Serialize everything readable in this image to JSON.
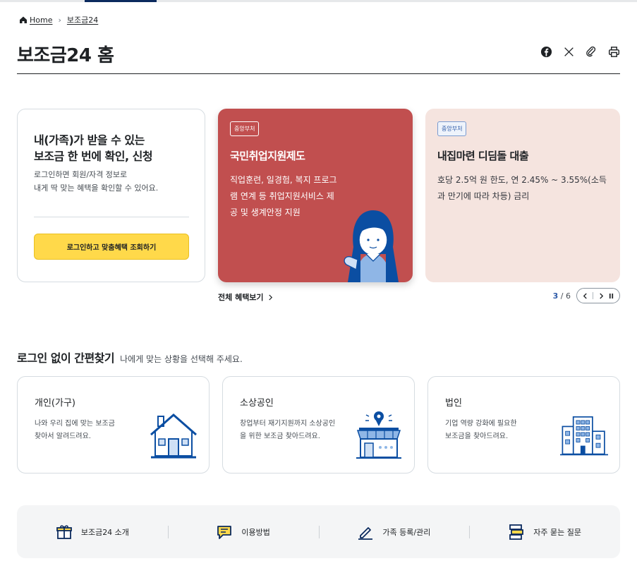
{
  "breadcrumb": {
    "home": "Home",
    "current": "보조금24"
  },
  "page": {
    "title": "보조금24 홈"
  },
  "utility_icons": [
    "facebook-icon",
    "x-icon",
    "link-icon",
    "print-icon"
  ],
  "login_card": {
    "title_line1": "내(가족)가 받을 수 있는",
    "title_line2": "보조금 한 번에 확인, 신청",
    "desc_line1": "로그인하면 회원/자격 정보로",
    "desc_line2": "내게 딱 맞는 혜택을 확인할 수 있어요.",
    "button": "로그인하고 맞춤혜택 조회하기"
  },
  "slides": [
    {
      "badge": "중앙부처",
      "title": "국민취업지원제도",
      "desc": "직업훈련, 일경험, 복지 프로그램 연계 등 취업지원서비스 제공 및 생계안정 지원",
      "bg": "#c14f4f"
    },
    {
      "badge": "중앙부처",
      "title": "내집마련 디딤돌 대출",
      "desc": "호당 2.5억 원 한도, 연 2.45% ~ 3.55%(소득과 만기에 따라 차등) 금리",
      "bg": "#f5e4df"
    }
  ],
  "carousel": {
    "more": "전체 혜택보기",
    "current": "3",
    "total": "/ 6"
  },
  "quick_find": {
    "title": "로그인 없이 간편찾기",
    "subtitle": "나에게 맞는 상황을 선택해 주세요.",
    "categories": [
      {
        "title": "개인(가구)",
        "desc_line1": "나와 우리 집에 맞는 보조금",
        "desc_line2": "찾아서 알려드려요.",
        "icon": "house-icon"
      },
      {
        "title": "소상공인",
        "desc_line1": "창업부터 재기지원까지 소상공인",
        "desc_line2": "을 위한 보조금 찾아드려요.",
        "icon": "store-icon"
      },
      {
        "title": "법인",
        "desc_line1": "기업 역량 강화에 필요한",
        "desc_line2": "보조금을 찾아드려요.",
        "icon": "building-icon"
      }
    ]
  },
  "bottom_links": [
    {
      "label": "보조금24 소개",
      "icon": "gift-icon"
    },
    {
      "label": "이용방법",
      "icon": "chat-icon"
    },
    {
      "label": "가족 등록/관리",
      "icon": "pencil-icon"
    },
    {
      "label": "자주 묻는 질문",
      "icon": "faq-icon"
    }
  ],
  "colors": {
    "accent": "#0b2a5e",
    "brand_blue": "#2d5aa8",
    "cta_yellow": "#ffd94a",
    "slide_red": "#c14f4f",
    "slide_pink": "#f5e4df"
  }
}
